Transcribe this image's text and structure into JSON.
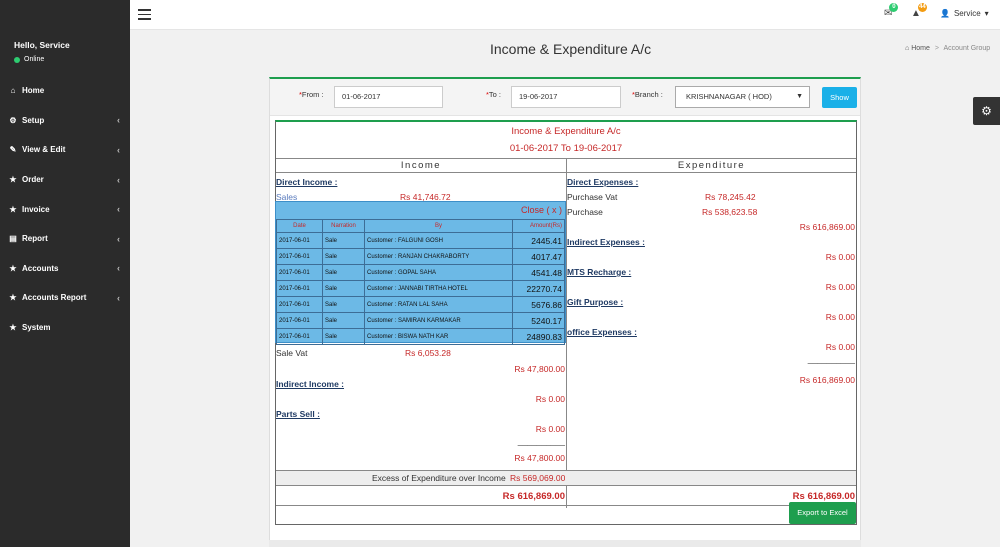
{
  "sidebar": {
    "greeting": "Hello, Service",
    "status": "Online",
    "items": [
      {
        "label": "Home",
        "icon": "home-icon",
        "glyph": "⌂",
        "chevron": false
      },
      {
        "label": "Setup",
        "icon": "cogs-icon",
        "glyph": "⚙",
        "chevron": true
      },
      {
        "label": "View & Edit",
        "icon": "edit-icon",
        "glyph": "✎",
        "chevron": true
      },
      {
        "label": "Order",
        "icon": "star-icon",
        "glyph": "★",
        "chevron": true
      },
      {
        "label": "Invoice",
        "icon": "star-icon",
        "glyph": "★",
        "chevron": true
      },
      {
        "label": "Report",
        "icon": "report-icon",
        "glyph": "▤",
        "chevron": true
      },
      {
        "label": "Accounts",
        "icon": "star-icon",
        "glyph": "★",
        "chevron": true
      },
      {
        "label": "Accounts Report",
        "icon": "star-icon",
        "glyph": "★",
        "chevron": true
      },
      {
        "label": "System",
        "icon": "star-icon",
        "glyph": "★",
        "chevron": false
      }
    ]
  },
  "topbar": {
    "mail_count": "0",
    "alert_count": "44",
    "user_label": "Service",
    "mail_badge_color": "#2ecc71",
    "alert_badge_color": "#f39c12"
  },
  "page": {
    "title": "Income & Expenditure A/c",
    "breadcrumb_home": "Home",
    "breadcrumb_current": "Account Group"
  },
  "filter": {
    "from_label": "From :",
    "from_value": "01-06-2017",
    "to_label": "To :",
    "to_value": "19-06-2017",
    "branch_label": "Branch :",
    "branch_value": "KRISHNANAGAR ( HOD)",
    "show_label": "Show"
  },
  "report": {
    "title": "Income & Expenditure A/c",
    "period": "01-06-2017 To 19-06-2017",
    "income_header": "Income",
    "expenditure_header": "Expenditure",
    "income": {
      "direct_income_label": "Direct Income :",
      "sales_label": "Sales",
      "sales_amount": "Rs 41,746.72",
      "sale_vat_label": "Sale Vat",
      "sale_vat_amount": "Rs 6,053.28",
      "direct_total": "Rs 47,800.00",
      "indirect_income_label": "Indirect Income :",
      "indirect_amount": "Rs 0.00",
      "parts_sell_label": "Parts Sell :",
      "parts_sell_amount": "Rs 0.00",
      "dash_line": "__________",
      "grand": "Rs 47,800.00"
    },
    "expenditure": {
      "direct_expenses_label": "Direct Expenses :",
      "purchase_vat_label": "Purchase Vat",
      "purchase_vat_amount": "Rs 78,245.42",
      "purchase_label": "Purchase",
      "purchase_amount": "Rs 538,623.58",
      "direct_total": "Rs 616,869.00",
      "indirect_expenses_label": "Indirect Expenses :",
      "indirect_amount": "Rs 0.00",
      "mts_label": "MTS Recharge :",
      "mts_amount": "Rs 0.00",
      "gift_label": "Gift Purpose :",
      "gift_amount": "Rs 0.00",
      "office_label": "office Expenses :",
      "office_amount": "Rs 0.00",
      "dash_line": "__________",
      "grand": "Rs 616,869.00"
    },
    "excess_label": "Excess of Expenditure over Income",
    "excess_amount": "Rs 569,069.00",
    "total_income": "Rs 616,869.00",
    "total_expenditure": "Rs 616,869.00",
    "export_label": "Export to Excel"
  },
  "popup": {
    "close_label": "Close ( x )",
    "headers": [
      "Date",
      "Narration",
      "By",
      "Amount(Rs)"
    ],
    "rows": [
      [
        "2017-06-01",
        "Sale",
        "Customer : FALGUNI GOSH",
        "2445.41"
      ],
      [
        "2017-06-01",
        "Sale",
        "Customer : RANJAN CHAKRABORTY",
        "4017.47"
      ],
      [
        "2017-06-01",
        "Sale",
        "Customer : GOPAL SAHA",
        "4541.48"
      ],
      [
        "2017-06-01",
        "Sale",
        "Customer : JANNABI TIRTHA HOTEL",
        "22270.74"
      ],
      [
        "2017-06-01",
        "Sale",
        "Customer : RATAN LAL SAHA",
        "5676.86"
      ],
      [
        "2017-06-01",
        "Sale",
        "Customer : SAMIRAN KARMAKAR",
        "5240.17"
      ],
      [
        "2017-06-01",
        "Sale",
        "Customer : BISWA NATH KAR",
        "24890.83"
      ]
    ]
  }
}
